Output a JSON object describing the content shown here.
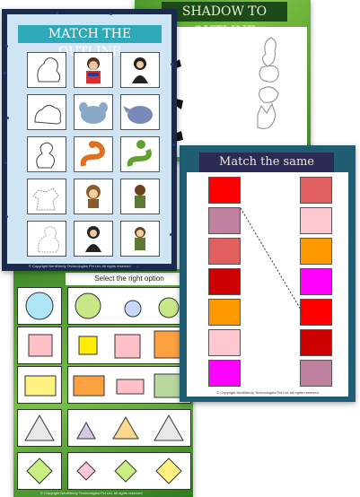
{
  "shadow_sheet": {
    "title": "SHADOW TO OUTLINE"
  },
  "shape_sheet": {
    "header": "Select the right option",
    "copyright": "© Copyright NerdNerdy Technologies Pvt Ltd. All rights reserved"
  },
  "shade_sheet": {
    "title": "Match the same SHADE",
    "left": [
      "#ff0000",
      "#c080a0",
      "#e06060",
      "#cc0000",
      "#ff9900",
      "#ffc8d0",
      "#ff00ff"
    ],
    "right": [
      "#e06060",
      "#ffc8d0",
      "#ff9900",
      "#ff00ff",
      "#ff0000",
      "#cc0000",
      "#c080a0"
    ],
    "copyright": "© Copyright NerdNerdy Technologies Pvt Ltd. All rights reserved"
  },
  "outline_sheet": {
    "title": "MATCH THE OUTLINE",
    "copyright": "© Copyright NerdNerdy Technologies Pvt Ltd. All rights reserved"
  }
}
